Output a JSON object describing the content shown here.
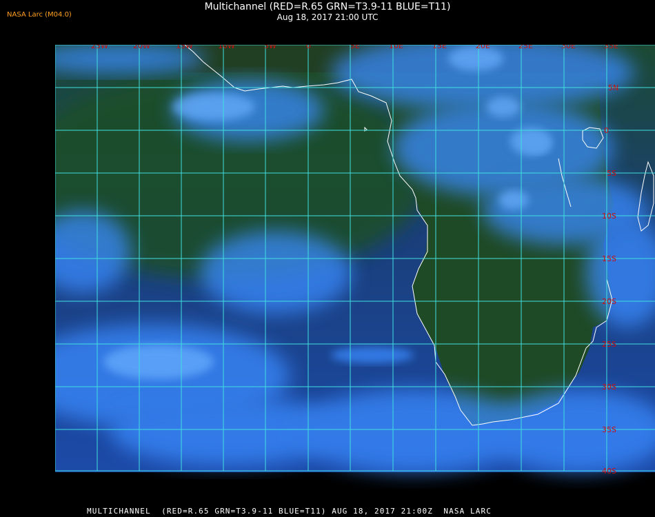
{
  "header": {
    "title": "Multichannel (RED=R.65 GRN=T3.9-11 BLUE=T11)",
    "subtitle": "Aug 18, 2017 21:00 UTC"
  },
  "corner_label": "NASA Larc (M04.0)",
  "footer": "MULTICHANNEL  (RED=R.65 GRN=T3.9-11 BLUE=T11) AUG 18, 2017 21:00Z  NASA LARC",
  "map": {
    "longitude_labels": [
      "25W",
      "20W",
      "15W",
      "10W",
      "5W",
      "0",
      "5E",
      "10E",
      "15E",
      "20E",
      "25E",
      "30E",
      "35E"
    ],
    "latitude_labels": [
      "5N",
      "0",
      "5S",
      "10S",
      "15S",
      "20S",
      "25S",
      "30S",
      "35S",
      "40S"
    ]
  },
  "colors": {
    "grid": "#40e0e0",
    "label": "#cc1010",
    "coastline": "#ffffff",
    "land": "#1d4a1f",
    "ocean": "#1a3f9a",
    "cloud": "#3a8bff",
    "header_text": "#ffffff",
    "corner_text": "#ffa020"
  }
}
